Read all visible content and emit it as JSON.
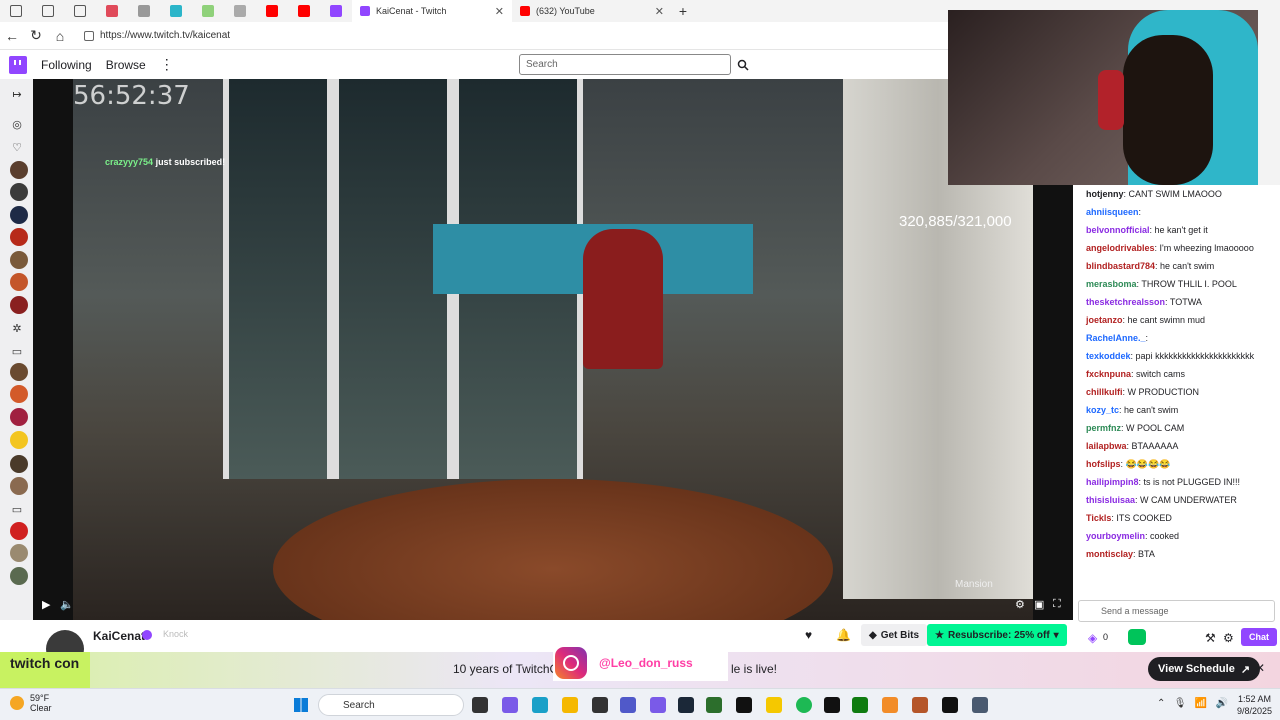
{
  "browser": {
    "tabs": [
      {
        "title": "KaiCenat - Twitch",
        "color": "#9146ff",
        "active": true
      },
      {
        "title": "(632) YouTube",
        "color": "#ff0000",
        "active": false
      }
    ],
    "url": "https://www.twitch.tv/kaicenat"
  },
  "twitch_nav": {
    "following": "Following",
    "browse": "Browse",
    "search_placeholder": "Search"
  },
  "video": {
    "timer": "56:52:37",
    "sub_user": "crazyyy754",
    "sub_text": "just subscribed!",
    "sub_count": "320,885/321,000",
    "watermark": "Mansion"
  },
  "channel": {
    "name": "KaiCenat",
    "knock": "Knock",
    "bits_label": "Get Bits",
    "resub_label": "Resubscribe: 25% off"
  },
  "banner": {
    "logo": "twitch con",
    "text_left": "10 years of TwitchC",
    "text_right": "le is live!",
    "schedule_button": "View Schedule",
    "ig_handle": "@Leo_don_russ"
  },
  "chat": {
    "messages": [
      {
        "user": "hotjenny",
        "color": "#1f1f23",
        "text": "CANT SWIM LMAOOO"
      },
      {
        "user": "ahniisqueen",
        "color": "#1e69ff",
        "text": ""
      },
      {
        "user": "belvonnofficial",
        "color": "#8a2be2",
        "text": "he kan't get it"
      },
      {
        "user": "angelodrivables",
        "color": "#b22222",
        "text": "I'm wheezing lmaooooo"
      },
      {
        "user": "blindbastard784",
        "color": "#b22222",
        "text": "he can't swim"
      },
      {
        "user": "merasboma",
        "color": "#2e8b57",
        "text": "THROW THLIL I. POOL"
      },
      {
        "user": "thesketchrealsson",
        "color": "#8a2be2",
        "text": "TOTWA"
      },
      {
        "user": "joetanzo",
        "color": "#b22222",
        "text": "he cant swimn mud"
      },
      {
        "user": "RachelAnne._",
        "color": "#1e69ff",
        "text": ""
      },
      {
        "user": "texkoddek",
        "color": "#1e69ff",
        "text": "papi kkkkkkkkkkkkkkkkkkkkkk"
      },
      {
        "user": "fxcknpuna",
        "color": "#b22222",
        "text": "switch cams"
      },
      {
        "user": "chillkulfi",
        "color": "#b22222",
        "text": "W PRODUCTION"
      },
      {
        "user": "kozy_tc",
        "color": "#1e69ff",
        "text": "he can't swim"
      },
      {
        "user": "permfnz",
        "color": "#2e8b57",
        "text": "W POOL CAM"
      },
      {
        "user": "lailapbwa",
        "color": "#b22222",
        "text": "BTAAAAAA"
      },
      {
        "user": "hofslips",
        "color": "#b22222",
        "text": "😂😂😂😂"
      },
      {
        "user": "hailipimpin8",
        "color": "#8a2be2",
        "text": "ts is not PLUGGED IN!!!"
      },
      {
        "user": "thisisluisaa",
        "color": "#8a2be2",
        "text": "W CAM UNDERWATER"
      },
      {
        "user": "Tickls",
        "color": "#b22222",
        "text": "ITS COOKED"
      },
      {
        "user": "yourboymelin",
        "color": "#8a2be2",
        "text": "cooked"
      },
      {
        "user": "montisclay",
        "color": "#b22222",
        "text": "BTA"
      }
    ],
    "input_placeholder": "Send a message",
    "points": "0",
    "chat_button": "Chat"
  },
  "taskbar": {
    "temp": "59°F",
    "condition": "Clear",
    "search": "Search",
    "time": "1:52 AM",
    "date": "9/8/2025"
  }
}
